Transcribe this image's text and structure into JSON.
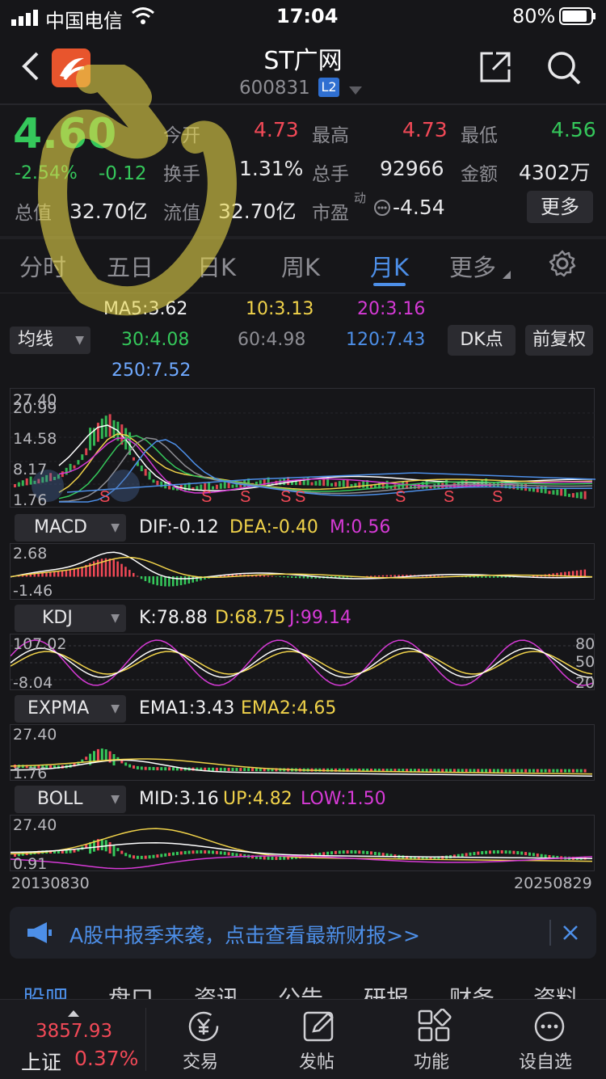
{
  "status": {
    "carrier": "中国电信",
    "time": "17:04",
    "battery": "80%"
  },
  "header": {
    "title": "ST广网",
    "code": "600831",
    "level_badge": "L2"
  },
  "quote": {
    "price": "4.60",
    "change_pct": "-2.54%",
    "change": "-0.12",
    "open_label": "今开",
    "open": "4.73",
    "high_label": "最高",
    "high": "4.73",
    "low_label": "最低",
    "low": "4.56",
    "turnover_label": "换手",
    "turnover": "1.31%",
    "volume_label": "总手",
    "volume": "92966",
    "amount_label": "金额",
    "amount": "4302万",
    "mktcap_label": "总值",
    "mktcap": "32.70亿",
    "float_label": "流值",
    "float": "32.70亿",
    "pe_label": "市盈",
    "pe_sup": "动",
    "pe": "-4.54",
    "more_button": "更多"
  },
  "tabs": [
    {
      "label": "分时"
    },
    {
      "label": "五日"
    },
    {
      "label": "日K"
    },
    {
      "label": "周K"
    },
    {
      "label": "月K"
    },
    {
      "label": "更多"
    }
  ],
  "ma_panel": {
    "selector": "均线",
    "ma5": "MA5:3.62",
    "ma10": "10:3.13",
    "ma20": "20:3.16",
    "ma30": "30:4.08",
    "ma60": "60:4.98",
    "ma120": "120:7.43",
    "ma250": "250:7.52",
    "dk_button": "DK点",
    "restore_button": "前复权"
  },
  "kline": {
    "y_labels": [
      "27.40",
      "20.99",
      "14.58",
      "8.17",
      "1.76"
    ],
    "signal": "S"
  },
  "macd": {
    "selector": "MACD",
    "dif": "DIF:-0.12",
    "dea": "DEA:-0.40",
    "m": "M:0.56",
    "y_top": "2.68",
    "y_bottom": "-1.46"
  },
  "kdj": {
    "selector": "KDJ",
    "k": "K:78.88",
    "d": "D:68.75",
    "j": "J:99.14",
    "y_top": "107.02",
    "y_bottom": "-8.04",
    "r80": "80",
    "r50": "50",
    "r20": "20"
  },
  "expma": {
    "selector": "EXPMA",
    "ema1": "EMA1:3.43",
    "ema2": "EMA2:4.65",
    "y_top": "27.40",
    "y_bottom": "1.76"
  },
  "boll": {
    "selector": "BOLL",
    "mid": "MID:3.16",
    "up": "UP:4.82",
    "low": "LOW:1.50",
    "y_top": "27.40",
    "y_bottom": "0.91",
    "date_start": "20130830",
    "date_end": "20250829"
  },
  "banner": {
    "text": "A股中报季来袭，点击查看最新财报>>"
  },
  "sub_tabs": [
    "股吧",
    "盘口",
    "资讯",
    "公告",
    "研报",
    "财务",
    "资料"
  ],
  "bottom_bar": {
    "index_value": "3857.93",
    "index_name": "上证",
    "index_pct": "0.37%",
    "items": [
      {
        "label": "交易",
        "icon": "yen-cycle-icon"
      },
      {
        "label": "发帖",
        "icon": "edit-icon"
      },
      {
        "label": "功能",
        "icon": "grid-icon"
      },
      {
        "label": "设自选",
        "icon": "more-icon"
      }
    ]
  },
  "colors": {
    "up": "#f24957",
    "down": "#35c85b",
    "accent": "#4d8fe8",
    "ma5": "#ffffff",
    "ma10": "#f0d24a",
    "ma20": "#d63ad6",
    "ma30": "#35c85b",
    "ma60": "#8d8d93",
    "ma120": "#4d8fe8"
  }
}
